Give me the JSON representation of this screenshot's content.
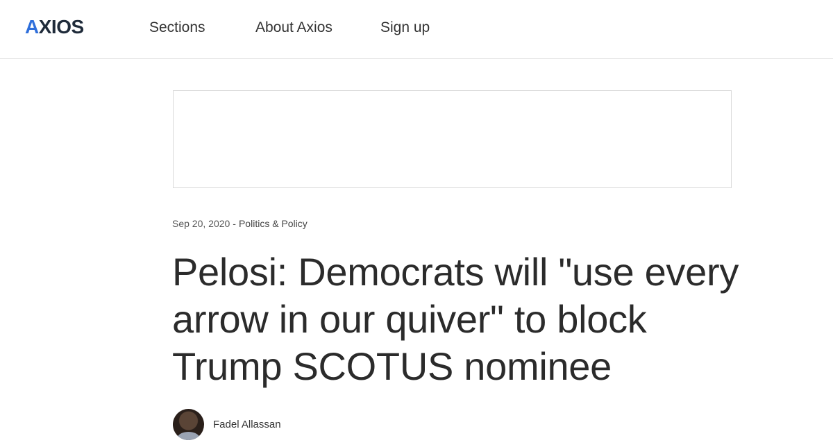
{
  "header": {
    "logo_text_a": "A",
    "logo_text_rest": "XIOS",
    "nav": {
      "sections": "Sections",
      "about": "About Axios",
      "signup": "Sign up"
    }
  },
  "article": {
    "date": "Sep 20, 2020",
    "separator": "-",
    "category": "Politics & Policy",
    "headline": "Pelosi: Democrats will \"use every arrow in our quiver\" to block Trump SCOTUS nominee",
    "author": "Fadel Allassan"
  },
  "colors": {
    "brand_accent": "#2f6fdb",
    "logo_dark": "#1f2b3a"
  }
}
